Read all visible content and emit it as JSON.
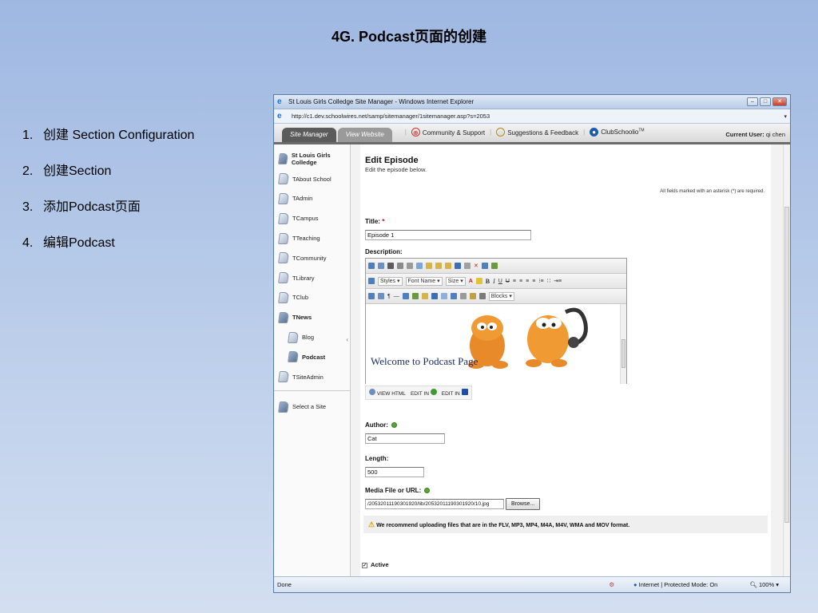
{
  "slide": {
    "title": "4G. Podcast页面的创建",
    "steps": [
      {
        "num": "1.",
        "text": "创建 Section Configuration"
      },
      {
        "num": "2.",
        "text": "创建Section"
      },
      {
        "num": "3.",
        "text": "添加Podcast页面"
      },
      {
        "num": "4.",
        "text": "编辑Podcast"
      }
    ]
  },
  "browser": {
    "window_title": "St Louis Girls Colledge Site Manager - Windows Internet Explorer",
    "url": "http://c1.dev.schoolwires.net/samp/sitemanager/1sitemanager.asp?s=2053",
    "status": {
      "left": "Done",
      "zone": "Internet | Protected Mode: On",
      "zoom": "100%"
    }
  },
  "app": {
    "tabs": [
      "Site Manager",
      "View Website"
    ],
    "nav_links": [
      "Community & Support",
      "Suggestions & Feedback",
      "ClubSchoolio"
    ],
    "current_user_label": "Current User:",
    "current_user": "qi chen",
    "sidebar": {
      "site": "St Louis Girls Colledge",
      "items": [
        "TAbout School",
        "TAdmin",
        "TCampus",
        "TTeaching",
        "TCommunity",
        "TLibrary",
        "TClub",
        "TNews"
      ],
      "sub_items": [
        "Blog",
        "Podcast"
      ],
      "last_item": "TSiteAdmin",
      "select_site": "Select a Site"
    },
    "form": {
      "heading": "Edit Episode",
      "subheading": "Edit the episode below.",
      "required_note": "All fields marked with an asterisk (*) are required.",
      "title_label": "Title:",
      "title_value": "Episode 1",
      "description_label": "Description:",
      "editor": {
        "styles": "Styles",
        "font_name": "Font Name",
        "size": "Size",
        "blocks": "Blocks",
        "body_text": "Welcome to Podcast Page",
        "modes": [
          "VIEW HTML",
          "EDIT IN",
          "EDIT IN"
        ]
      },
      "author_label": "Author:",
      "author_value": "Cat",
      "length_label": "Length:",
      "length_value": "500",
      "media_label": "Media File or URL:",
      "media_value": "/20532011190301920/lib/20532011190301920/10.jpg",
      "browse_button": "Browse...",
      "warning": "We recommend uploading files that are in the FLV, MP3, MP4, M4A, M4V, WMA and MOV format.",
      "active_label": "Active"
    }
  },
  "colors": {
    "background_top": "#9fb8e2",
    "background_bottom": "#d3dff1",
    "tab_active": "#5b5b5b",
    "welcome_text": "#1b2e6b"
  }
}
